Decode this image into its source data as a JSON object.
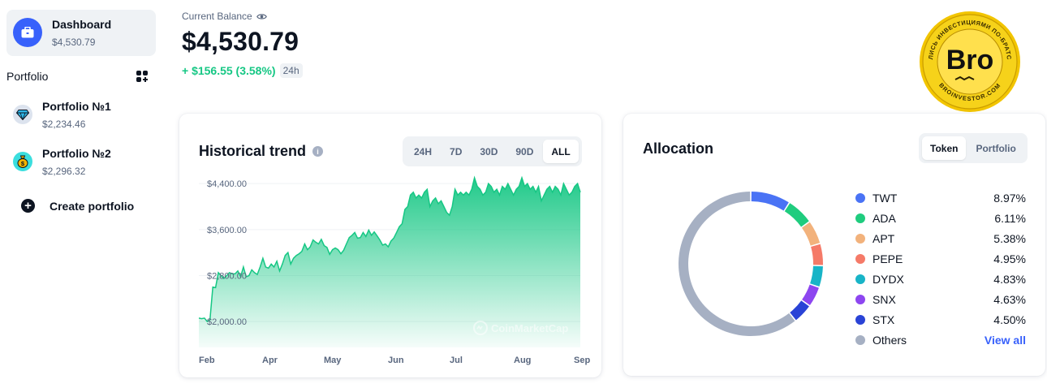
{
  "sidebar": {
    "dashboard": {
      "title": "Dashboard",
      "value": "$4,530.79",
      "icon": "briefcase-icon"
    },
    "portfolio_header": "Portfolio",
    "portfolios": [
      {
        "name": "Portfolio №1",
        "value": "$2,234.46",
        "icon": "diamond-icon"
      },
      {
        "name": "Portfolio №2",
        "value": "$2,296.32",
        "icon": "money-bag-icon"
      }
    ],
    "create_label": "Create portfolio"
  },
  "balance": {
    "label": "Current Balance",
    "value": "$4,530.79",
    "change": "+ $156.55 (3.58%)",
    "period": "24h"
  },
  "logo": {
    "main_text": "Bro",
    "ring_text_top": "ДЕЛИСЬ ИНВЕСТИЦИЯМИ ПО-БРАТСКИ",
    "ring_text_bottom": "BROINVESTOR.COM"
  },
  "trend": {
    "title": "Historical trend",
    "ranges": [
      "24H",
      "7D",
      "30D",
      "90D",
      "ALL"
    ],
    "active_range": "ALL",
    "watermark": "CoinMarketCap"
  },
  "allocation": {
    "title": "Allocation",
    "tabs": [
      "Token",
      "Portfolio"
    ],
    "active_tab": "Token",
    "view_all": "View all",
    "items": [
      {
        "name": "TWT",
        "pct": "8.97%",
        "value": 8.97,
        "color": "#4a73f5"
      },
      {
        "name": "ADA",
        "pct": "6.11%",
        "value": 6.11,
        "color": "#1fcc7e"
      },
      {
        "name": "APT",
        "pct": "5.38%",
        "value": 5.38,
        "color": "#f2b27c"
      },
      {
        "name": "PEPE",
        "pct": "4.95%",
        "value": 4.95,
        "color": "#f57a68"
      },
      {
        "name": "DYDX",
        "pct": "4.83%",
        "value": 4.83,
        "color": "#18b4c7"
      },
      {
        "name": "SNX",
        "pct": "4.63%",
        "value": 4.63,
        "color": "#8d46f0"
      },
      {
        "name": "STX",
        "pct": "4.50%",
        "value": 4.5,
        "color": "#2a43d6"
      },
      {
        "name": "Others",
        "pct": "",
        "value": 60.63,
        "color": "#a6b0c3"
      }
    ]
  },
  "chart_data": {
    "type": "area",
    "x_ticks": [
      "Feb",
      "Apr",
      "May",
      "Jun",
      "Jul",
      "Aug",
      "Sep"
    ],
    "y_ticks": [
      "$2,000.00",
      "$2,800.00",
      "$3,600.00",
      "$4,400.00"
    ],
    "y_tick_values": [
      2000,
      2800,
      3600,
      4400
    ],
    "ylim": [
      1550,
      4600
    ],
    "color": "#16c784",
    "series": [
      {
        "values": [
          2060,
          2050,
          2060,
          2000,
          2030,
          2600,
          2590,
          2850,
          2800,
          2750,
          2800,
          2850,
          2830,
          2830,
          2880,
          2780,
          2950,
          2780,
          2800,
          2900,
          2850,
          2820,
          2950,
          3100,
          2950,
          2930,
          3000,
          2950,
          3050,
          2880,
          3000,
          3150,
          3200,
          3000,
          3100,
          3150,
          3180,
          3220,
          3350,
          3250,
          3300,
          3420,
          3380,
          3350,
          3430,
          3320,
          3290,
          3170,
          3250,
          3280,
          3250,
          3180,
          3240,
          3350,
          3460,
          3500,
          3550,
          3450,
          3460,
          3550,
          3480,
          3590,
          3500,
          3560,
          3490,
          3420,
          3330,
          3350,
          3300,
          3400,
          3450,
          3550,
          3650,
          3700,
          3950,
          4000,
          4200,
          4250,
          4150,
          4200,
          4150,
          4250,
          4300,
          4000,
          4100,
          4150,
          4050,
          4100,
          4000,
          3900,
          3850,
          4000,
          4300,
          4200,
          4250,
          4200,
          4250,
          4200,
          4300,
          4500,
          4350,
          4300,
          4200,
          4250,
          4400,
          4350,
          4250,
          4300,
          4200,
          4350,
          4300,
          4400,
          4300,
          4200,
          4300,
          4350,
          4500,
          4350,
          4400,
          4300,
          4350,
          4250,
          4350,
          4100,
          4200,
          4300,
          4350,
          4250,
          4350,
          4300,
          4200,
          4400,
          4300,
          4200,
          4250,
          4350,
          4400,
          4250
        ]
      }
    ]
  }
}
